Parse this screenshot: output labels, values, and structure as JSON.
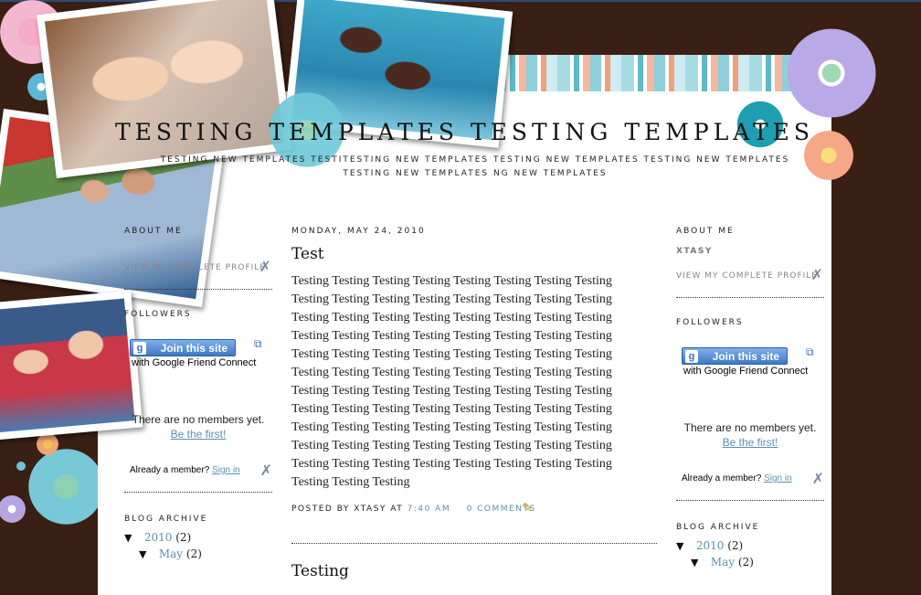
{
  "blog": {
    "title": "TESTING TEMPLATES TESTING TEMPLATES",
    "description": "TESTING NEW TEMPLATES TESTITESTING NEW TEMPLATES TESTING NEW TEMPLATES TESTING NEW TEMPLATES TESTING NEW TEMPLATES NG NEW TEMPLATES"
  },
  "left_sidebar": {
    "about_heading": "ABOUT ME",
    "profile_link": "VIEW MY COMPLETE PROFILE",
    "followers_heading": "FOLLOWERS",
    "join_label": "Join this site",
    "gfc_label": "with Google Friend Connect",
    "no_members": "There are no members yet.",
    "be_first": "Be the first!",
    "already_member": "Already a member?",
    "sign_in": "Sign in",
    "archive_heading": "BLOG ARCHIVE",
    "archive_year": "2010",
    "archive_year_count": "(2)",
    "archive_month": "May",
    "archive_month_count": "(2)"
  },
  "right_sidebar": {
    "about_heading": "ABOUT ME",
    "author_name": "XTASY",
    "profile_link": "VIEW MY COMPLETE PROFILE",
    "followers_heading": "FOLLOWERS",
    "join_label": "Join this site",
    "gfc_label": "with Google Friend Connect",
    "no_members": "There are no members yet.",
    "be_first": "Be the first!",
    "already_member": "Already a member?",
    "sign_in": "Sign in",
    "archive_heading": "BLOG ARCHIVE",
    "archive_year": "2010",
    "archive_year_count": "(2)",
    "archive_month": "May",
    "archive_month_count": "(2)"
  },
  "post": {
    "date": "MONDAY, MAY 24, 2010",
    "title": "Test",
    "body": "Testing Testing Testing Testing Testing Testing Testing Testing Testing Testing Testing Testing Testing Testing Testing Testing Testing Testing Testing Testing Testing Testing Testing Testing Testing Testing Testing Testing Testing Testing Testing Testing Testing Testing Testing Testing Testing Testing Testing Testing Testing Testing Testing Testing Testing Testing Testing Testing Testing Testing Testing Testing Testing Testing Testing Testing Testing Testing Testing Testing Testing Testing Testing Testing Testing Testing Testing Testing Testing Testing Testing Testing Testing Testing Testing Testing Testing Testing Testing Testing Testing Testing Testing Testing Testing Testing Testing Testing Testing Testing Testing",
    "posted_by": "POSTED BY XTASY AT",
    "time": "7:40 AM",
    "comments": "0 COMMENTS"
  },
  "post2": {
    "title": "Testing"
  },
  "icons": {
    "wrench": "wrench-icon",
    "pencil": "pencil-icon",
    "popup": "popup-icon",
    "google": "google-icon"
  },
  "colors": {
    "background": "#3a1f14",
    "link": "#5d8fb0",
    "join_button": "#3e78c8"
  }
}
